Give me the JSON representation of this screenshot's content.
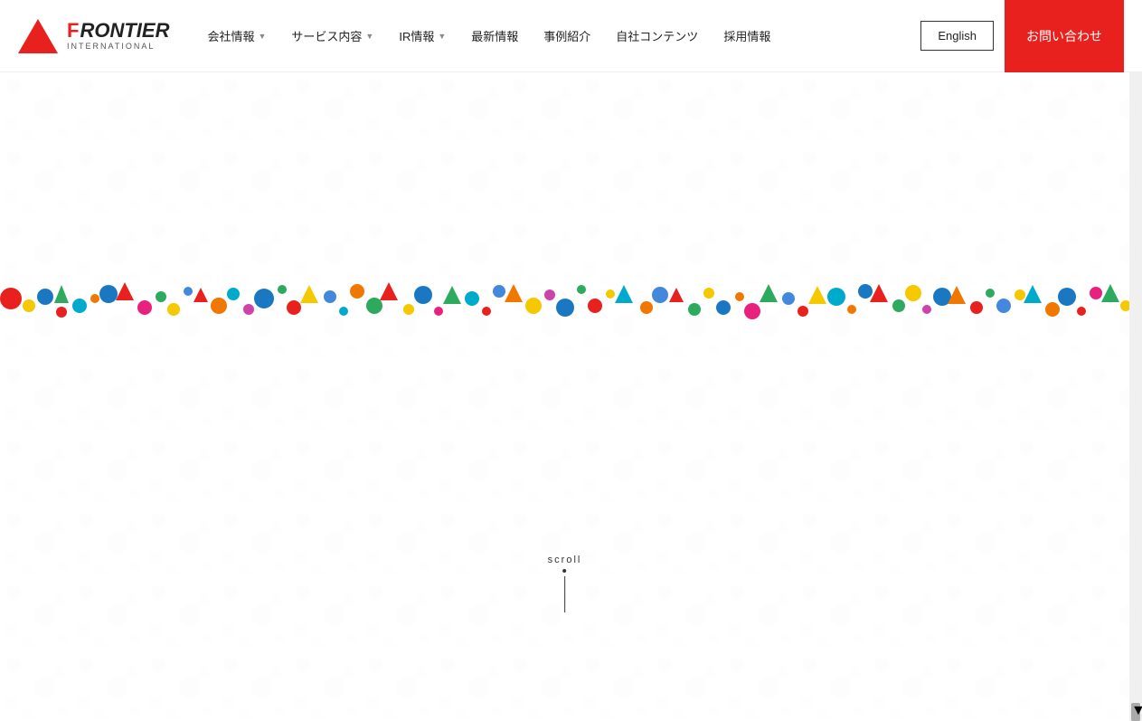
{
  "header": {
    "logo": {
      "frontier_text": "FRONTier",
      "international_text": "INTERNATIONAL"
    },
    "nav_items": [
      {
        "label": "会社情報",
        "has_dropdown": true
      },
      {
        "label": "サービス内容",
        "has_dropdown": true
      },
      {
        "label": "IR情報",
        "has_dropdown": true
      },
      {
        "label": "最新情報",
        "has_dropdown": false
      },
      {
        "label": "事例紹介",
        "has_dropdown": false
      },
      {
        "label": "自社コンテンツ",
        "has_dropdown": false
      },
      {
        "label": "採用情報",
        "has_dropdown": false
      }
    ],
    "english_label": "English",
    "contact_label": "お問い合わせ"
  },
  "main": {
    "scroll_label": "scroll"
  }
}
